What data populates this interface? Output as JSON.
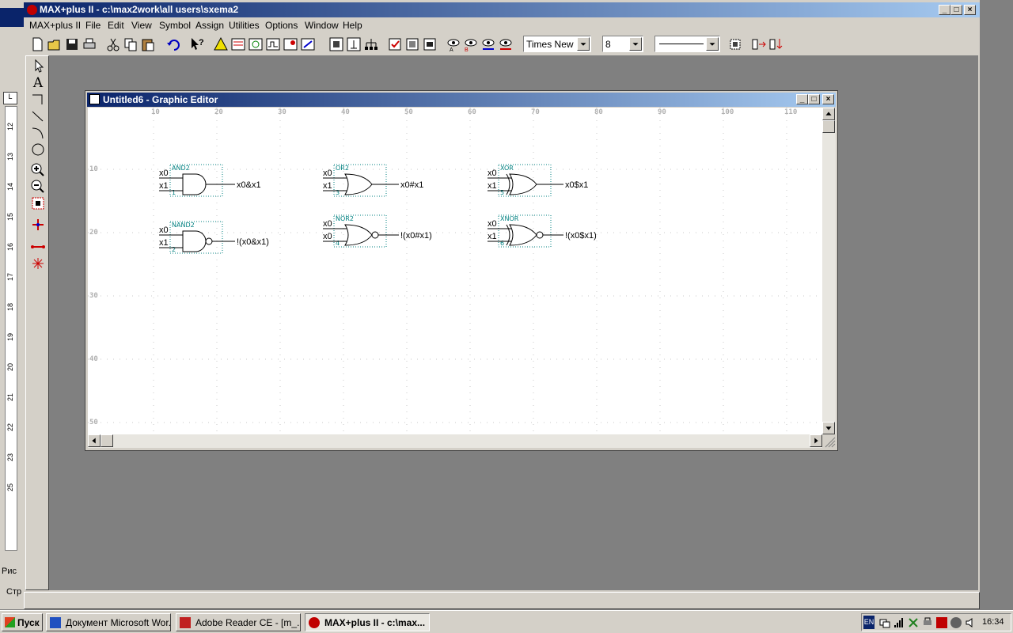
{
  "app": {
    "title": "MAX+plus II - c:\\max2work\\all users\\sxema2",
    "menu": [
      "MAX+plus II",
      "File",
      "Edit",
      "View",
      "Symbol",
      "Assign",
      "Utilities",
      "Options",
      "Window",
      "Help"
    ],
    "font_combo": "Times New",
    "size_combo": "8"
  },
  "editor": {
    "title": "Untitled6 - Graphic Editor",
    "ruler_top": [
      "10",
      "20",
      "30",
      "40",
      "50",
      "60",
      "70",
      "80",
      "90",
      "100",
      "110"
    ],
    "ruler_left": [
      "10",
      "20",
      "30",
      "40",
      "50"
    ],
    "gates": [
      {
        "type": "AND2",
        "num": "1",
        "in1": "x0",
        "in2": "x1",
        "out": "x0&x1"
      },
      {
        "type": "OR2",
        "num": "3",
        "in1": "x0",
        "in2": "x1",
        "out": "x0#x1"
      },
      {
        "type": "XOR",
        "num": "5",
        "in1": "x0",
        "in2": "x1",
        "out": "x0$x1"
      },
      {
        "type": "NAND2",
        "num": "2",
        "in1": "x0",
        "in2": "x1",
        "out": "!(x0&x1)"
      },
      {
        "type": "NOR2",
        "num": "4",
        "in1": "x0",
        "in2": "x0",
        "out": "!(x0#x1)"
      },
      {
        "type": "XNOR",
        "num": "6",
        "in1": "x0",
        "in2": "x1",
        "out": "!(x0$x1)"
      }
    ]
  },
  "background": {
    "ruler_numbers": [
      "12",
      "13",
      "14",
      "15",
      "16",
      "17",
      "18",
      "19",
      "20",
      "21",
      "22",
      "23",
      "25"
    ],
    "side_labels": [
      "Рис",
      "Стр"
    ]
  },
  "taskbar": {
    "start": "Пуск",
    "tasks": [
      "Документ Microsoft Wor...",
      "Adobe Reader CE - [m_...",
      "MAX+plus II - c:\\max..."
    ],
    "lang": "EN",
    "clock": "16:34"
  },
  "colors": {
    "title_active": "#0a246a",
    "gate_label": "#008080",
    "face": "#d4d0c8"
  }
}
